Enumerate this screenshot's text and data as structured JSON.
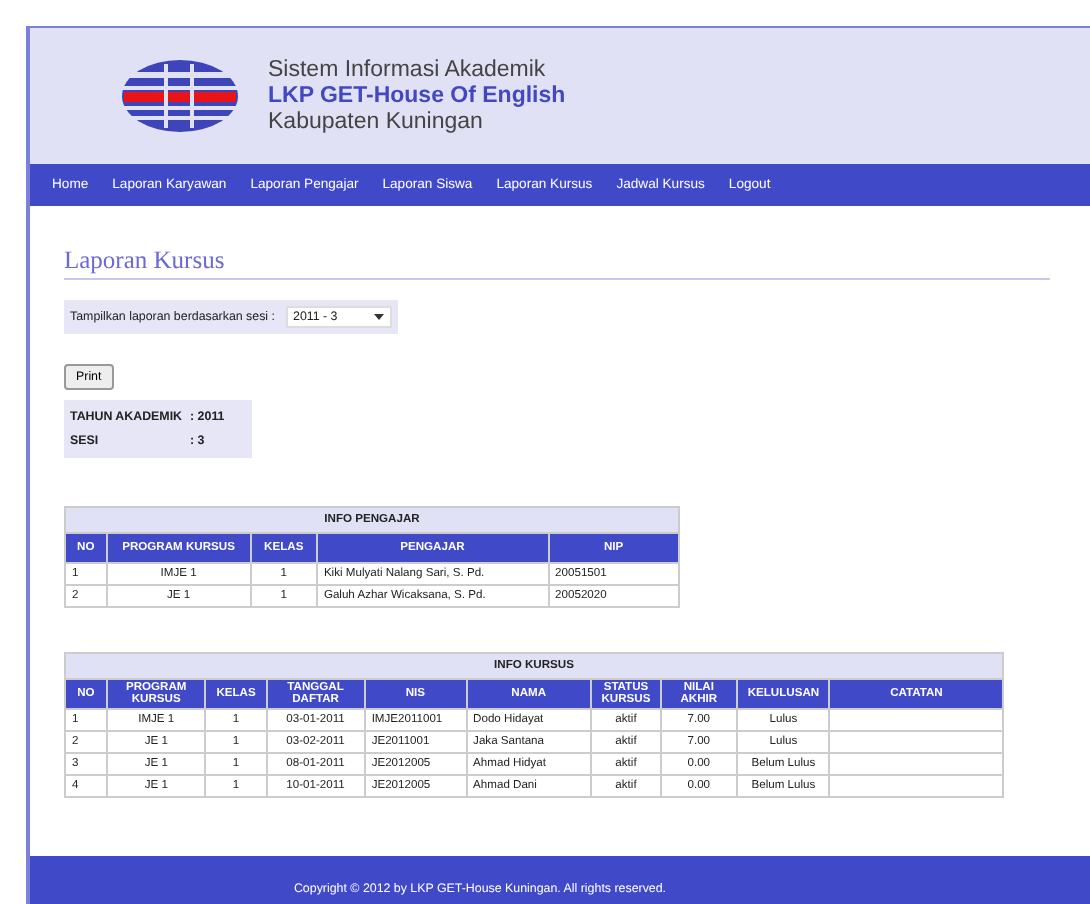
{
  "header": {
    "line1": "Sistem Informasi Akademik",
    "line2": "LKP GET-House Of English",
    "line3": "Kabupaten Kuningan"
  },
  "nav": [
    {
      "label": "Home"
    },
    {
      "label": "Laporan Karyawan"
    },
    {
      "label": "Laporan Pengajar"
    },
    {
      "label": "Laporan Siswa"
    },
    {
      "label": "Laporan Kursus"
    },
    {
      "label": "Jadwal Kursus"
    },
    {
      "label": "Logout"
    }
  ],
  "page_title": "Laporan Kursus",
  "session": {
    "label": "Tampilkan laporan berdasarkan sesi :",
    "value": "2011 - 3"
  },
  "print_button": "Print",
  "summary": [
    {
      "label": "TAHUN AKADEMIK",
      "value": ": 2011"
    },
    {
      "label": "SESI",
      "value": ": 3"
    }
  ],
  "tables": [
    {
      "title": "INFO PENGAJAR",
      "columns": [
        "NO",
        "PROGRAM KURSUS",
        "KELAS",
        "PENGAJAR",
        "NIP"
      ],
      "rows": [
        [
          "1",
          "IMJE 1",
          "1",
          "Kiki Mulyati Nalang Sari, S. Pd.",
          "20051501"
        ],
        [
          "2",
          "JE 1",
          "1",
          "Galuh Azhar Wicaksana, S. Pd.",
          "20052020"
        ]
      ]
    },
    {
      "title": "INFO KURSUS",
      "columns": [
        "NO",
        "PROGRAM KURSUS",
        "KELAS",
        "TANGGAL DAFTAR",
        "NIS",
        "NAMA",
        "STATUS KURSUS",
        "NILAI AKHIR",
        "KELULUSAN",
        "CATATAN"
      ],
      "rows": [
        [
          "1",
          "IMJE 1",
          "1",
          "03-01-2011",
          "IMJE2011001",
          "Dodo Hidayat",
          "aktif",
          "7.00",
          "Lulus",
          ""
        ],
        [
          "2",
          "JE 1",
          "1",
          "03-02-2011",
          "JE2011001",
          "Jaka Santana",
          "aktif",
          "7.00",
          "Lulus",
          ""
        ],
        [
          "3",
          "JE 1",
          "1",
          "08-01-2011",
          "JE2012005",
          "Ahmad Hidyat",
          "aktif",
          "0.00",
          "Belum Lulus",
          ""
        ],
        [
          "4",
          "JE 1",
          "1",
          "10-01-2011",
          "JE2012005",
          "Ahmad Dani",
          "aktif",
          "0.00",
          "Belum Lulus",
          ""
        ]
      ]
    }
  ],
  "footer": "Copyright © 2012 by LKP GET-House Kuningan. All rights reserved."
}
